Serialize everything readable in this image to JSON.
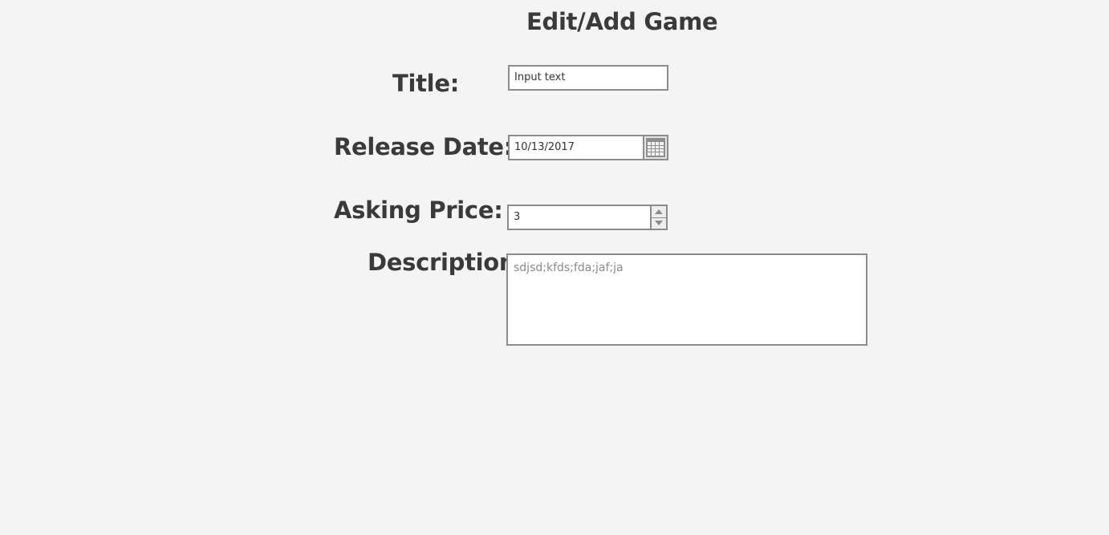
{
  "page": {
    "title": "Edit/Add Game"
  },
  "form": {
    "title_label": "Title:",
    "title_value": "Input text",
    "release_date_label": "Release Date:",
    "release_date_value": "10/13/2017",
    "asking_price_label": "Asking Price:",
    "asking_price_value": "3",
    "description_label": "Description",
    "description_value": "sdjsd;kfds;fda;jaf;ja"
  },
  "icons": {
    "date_picker": "calendar-icon",
    "spinner_up": "arrow-up-icon",
    "spinner_down": "arrow-down-icon"
  },
  "colors": {
    "background": "#f4f4f4",
    "text": "#3a3a3a",
    "border": "#8c8c8c",
    "placeholder_text": "#8a8a8a"
  }
}
